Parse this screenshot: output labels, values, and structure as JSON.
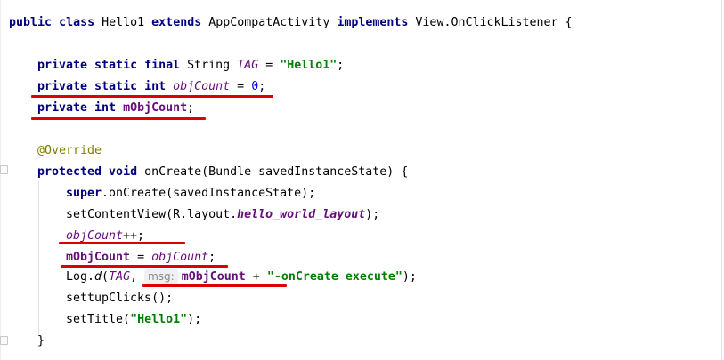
{
  "code": {
    "line1": {
      "kw_public": "public",
      "kw_class": "class",
      "class_name": "Hello1",
      "kw_extends": "extends",
      "superclass": "AppCompatActivity",
      "kw_implements": "implements",
      "interface": "View.OnClickListener",
      "brace": "{"
    },
    "line2": {
      "mods": "private static final",
      "type": "String",
      "name": "TAG",
      "eq": " = ",
      "value": "\"Hello1\"",
      "semi": ";"
    },
    "line3": {
      "mods": "private static int",
      "name": "objCount",
      "eq": " = ",
      "value": "0",
      "semi": ";"
    },
    "line4": {
      "mods": "private int",
      "name": "mObjCount",
      "semi": ";"
    },
    "line5": {
      "annotation": "@Override"
    },
    "line6": {
      "mods": "protected void",
      "text": "onCreate(Bundle savedInstanceState) {"
    },
    "line7": {
      "kw": "super",
      "text": ".onCreate(savedInstanceState);"
    },
    "line8": {
      "pre": "setContentView(R.layout.",
      "field": "hello_world_layout",
      "post": ");"
    },
    "line9": {
      "name": "objCount",
      "post": "++;"
    },
    "line10": {
      "name": "mObjCount",
      "eq": " = ",
      "value": "objCount",
      "semi": ";"
    },
    "line11": {
      "pre": "Log.",
      "method": "d",
      "open": "(",
      "tag": "TAG",
      "comma": ", ",
      "hint": "msg:",
      "field": "mObjCount",
      "plus": " + ",
      "str": "\"-onCreate execute\"",
      "post": ");"
    },
    "line12": {
      "text": "settupClicks();"
    },
    "line13": {
      "pre": "setTitle(",
      "str": "\"Hello1\"",
      "post": ");"
    },
    "line14": {
      "text": "}"
    }
  },
  "colors": {
    "keyword": "#000080",
    "field": "#660e7a",
    "string": "#008000",
    "number": "#0000ff",
    "annotation": "#808000",
    "underline": "#dd0000"
  }
}
